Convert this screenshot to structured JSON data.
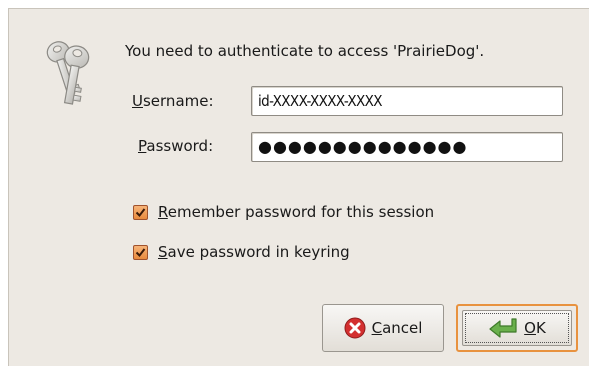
{
  "dialog": {
    "message": "You need to authenticate to access 'PrairieDog'.",
    "icon": "keys-icon"
  },
  "username": {
    "label_mnemonic": "U",
    "label_rest": "sername:",
    "value": "id-XXXX-XXXX-XXXX"
  },
  "password": {
    "label_mnemonic": "P",
    "label_rest": "assword:",
    "value": "●●●●●●●●●●●●●●"
  },
  "options": {
    "remember": {
      "checked": true,
      "label_mnemonic": "R",
      "label_rest": "emember password for this session"
    },
    "keyring": {
      "checked": true,
      "label_mnemonic": "S",
      "label_rest": "ave password in keyring"
    }
  },
  "buttons": {
    "cancel": {
      "mnemonic": "C",
      "rest": "ancel",
      "icon": "cancel-icon"
    },
    "ok": {
      "mnemonic": "O",
      "rest": "K",
      "icon": "enter-arrow-icon"
    }
  },
  "colors": {
    "dialog_bg": "#ede9e3",
    "accent_orange": "#e98a3d",
    "cancel_red": "#d32f2f",
    "ok_green": "#6ab04c"
  }
}
